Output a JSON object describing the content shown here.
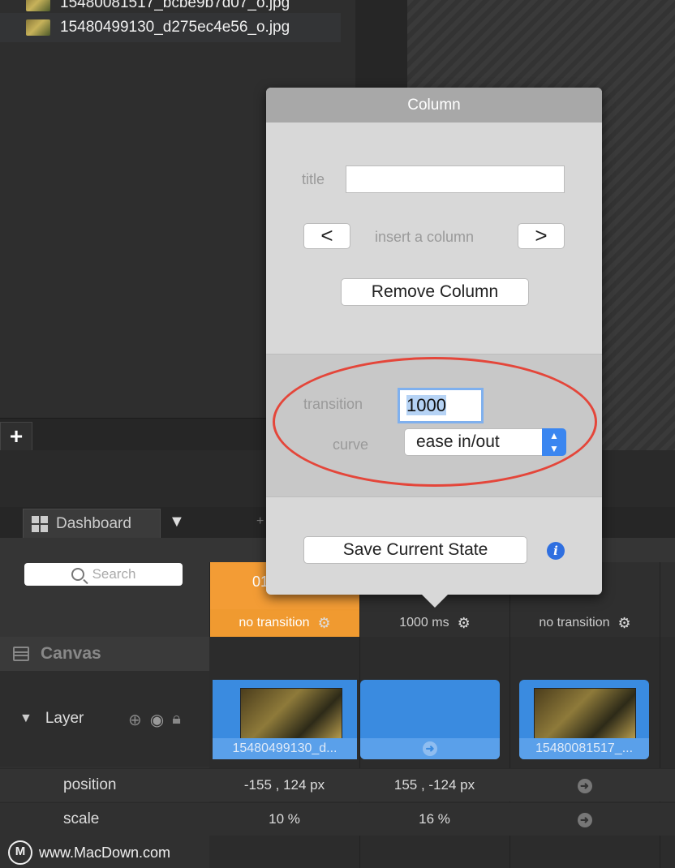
{
  "media": {
    "files": [
      "15480081517_bcbe9b7d07_o.jpg",
      "15480499130_d275ec4e56_o.jpg"
    ]
  },
  "tabs": {
    "dashboard_label": "Dashboard",
    "dropdown_glyph": "▼",
    "add_glyph": "+"
  },
  "sidebar": {
    "search_placeholder": "Search",
    "canvas_label": "Canvas",
    "layer_label": "Layer",
    "properties": [
      "position",
      "scale"
    ]
  },
  "columns": [
    {
      "number": "01",
      "transition": "no transition"
    },
    {
      "number": "",
      "transition": "1000  ms"
    },
    {
      "number": "",
      "transition": "no transition"
    }
  ],
  "layer_cells": [
    {
      "caption": "15480499130_d..."
    },
    {
      "caption": "➜"
    },
    {
      "caption": "15480081517_..."
    }
  ],
  "table": {
    "position": [
      "-155 , 124 px",
      "155 , -124 px",
      "➜"
    ],
    "scale": [
      "10 %",
      "16 %",
      "➜"
    ]
  },
  "popover": {
    "title": "Column",
    "title_label": "title",
    "title_value": "",
    "prev_glyph": "<",
    "next_glyph": ">",
    "insert_label": "insert a column",
    "remove_label": "Remove Column",
    "transition_label": "transition",
    "transition_value": "1000",
    "curve_label": "curve",
    "curve_value": "ease in/out",
    "save_label": "Save Current State",
    "info_glyph": "i"
  },
  "watermark": {
    "text": "www.MacDown.com",
    "logo": "M"
  },
  "colors": {
    "accent_orange": "#f39c35",
    "selection_blue": "#3a8be0",
    "annotation_red": "#e4463a"
  }
}
